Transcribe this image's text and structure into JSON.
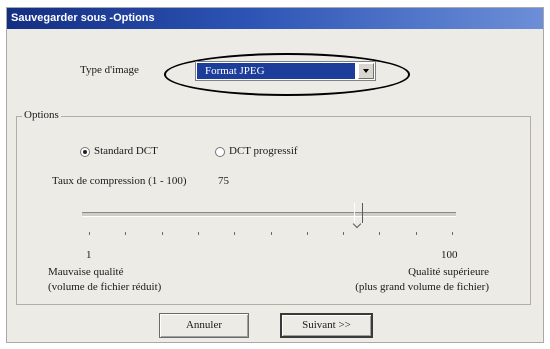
{
  "window": {
    "title": "Sauvegarder sous -Options"
  },
  "image_type": {
    "label": "Type d'image",
    "selected": "Format JPEG"
  },
  "options": {
    "group_label": "Options",
    "radio_standard": {
      "label": "Standard DCT",
      "selected": true
    },
    "radio_progressive": {
      "label": "DCT progressif",
      "selected": false
    },
    "compression_label": "Taux de compression (1 - 100)",
    "compression_value": "75"
  },
  "slider": {
    "min_label": "1",
    "max_label": "100",
    "value": 75,
    "low_quality_line1": "Mauvaise qualité",
    "low_quality_line2": "(volume de fichier réduit)",
    "high_quality_line1": "Qualité supérieure",
    "high_quality_line2": "(plus grand volume de fichier)"
  },
  "buttons": {
    "cancel": "Annuler",
    "next": "Suivant >>"
  }
}
